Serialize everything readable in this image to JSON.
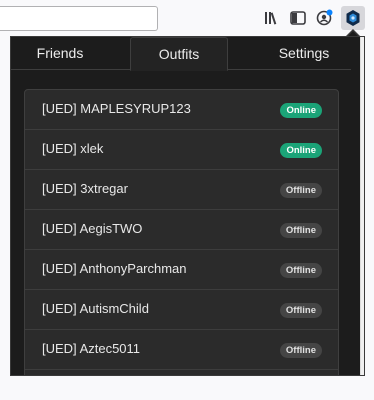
{
  "toolbar": {
    "library_icon": "library-icon",
    "sidebar_icon": "sidebar-icon",
    "account_icon": "account-icon",
    "extension_icon": "extension-icon"
  },
  "tabs": [
    {
      "label": "Friends",
      "active": false
    },
    {
      "label": "Outfits",
      "active": true
    },
    {
      "label": "Settings",
      "active": false
    }
  ],
  "members": [
    {
      "name": "[UED] MAPLESYRUP123",
      "status": "Online"
    },
    {
      "name": "[UED] xlek",
      "status": "Online"
    },
    {
      "name": "[UED] 3xtregar",
      "status": "Offline"
    },
    {
      "name": "[UED] AegisTWO",
      "status": "Offline"
    },
    {
      "name": "[UED] AnthonyParchman",
      "status": "Offline"
    },
    {
      "name": "[UED] AutismChild",
      "status": "Offline"
    },
    {
      "name": "[UED] Aztec5011",
      "status": "Offline"
    }
  ],
  "colors": {
    "online": "#1ba478",
    "offline": "#454545",
    "panel_bg": "#1c1c1c",
    "list_bg": "#2b2b2b"
  }
}
